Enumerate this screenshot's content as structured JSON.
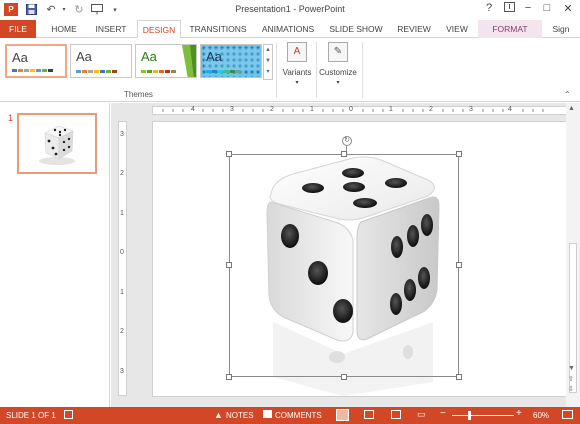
{
  "window": {
    "title": "Presentation1 - PowerPoint",
    "help": "?",
    "controls": [
      "−",
      "□",
      "✕"
    ]
  },
  "qat": {
    "app_icon": "powerpoint-icon",
    "save": "save-icon",
    "undo": "undo-icon",
    "redo": "redo-icon",
    "customize": "customize-qat-icon"
  },
  "tabs": [
    {
      "label": "FILE"
    },
    {
      "label": "HOME"
    },
    {
      "label": "INSERT"
    },
    {
      "label": "DESIGN"
    },
    {
      "label": "TRANSITIONS"
    },
    {
      "label": "ANIMATIONS"
    },
    {
      "label": "SLIDE SHOW"
    },
    {
      "label": "REVIEW"
    },
    {
      "label": "VIEW"
    },
    {
      "label": "FORMAT"
    }
  ],
  "signin": "Sign",
  "ribbon": {
    "themes_label": "Themes",
    "theme_tiles": [
      {
        "text": "Aa"
      },
      {
        "text": "Aa"
      },
      {
        "text": "Aa"
      },
      {
        "text": "Aa"
      }
    ],
    "variants_label": "Variants",
    "customize_label": "Customize"
  },
  "slides_pane": {
    "number": "1"
  },
  "ruler": {
    "h": [
      "4",
      "3",
      "2",
      "1",
      "0",
      "1",
      "2",
      "3",
      "4"
    ],
    "v": [
      "3",
      "2",
      "1",
      "0",
      "1",
      "2",
      "3"
    ]
  },
  "status": {
    "slide_info": "SLIDE 1 OF 1",
    "notes": "NOTES",
    "comments": "COMMENTS",
    "zoom": "60%",
    "zoom_level": 0.6
  },
  "colors": {
    "accent": "#d24726",
    "format_tab": "#f3e5ee",
    "theme_selected_border": "#f0a889"
  }
}
